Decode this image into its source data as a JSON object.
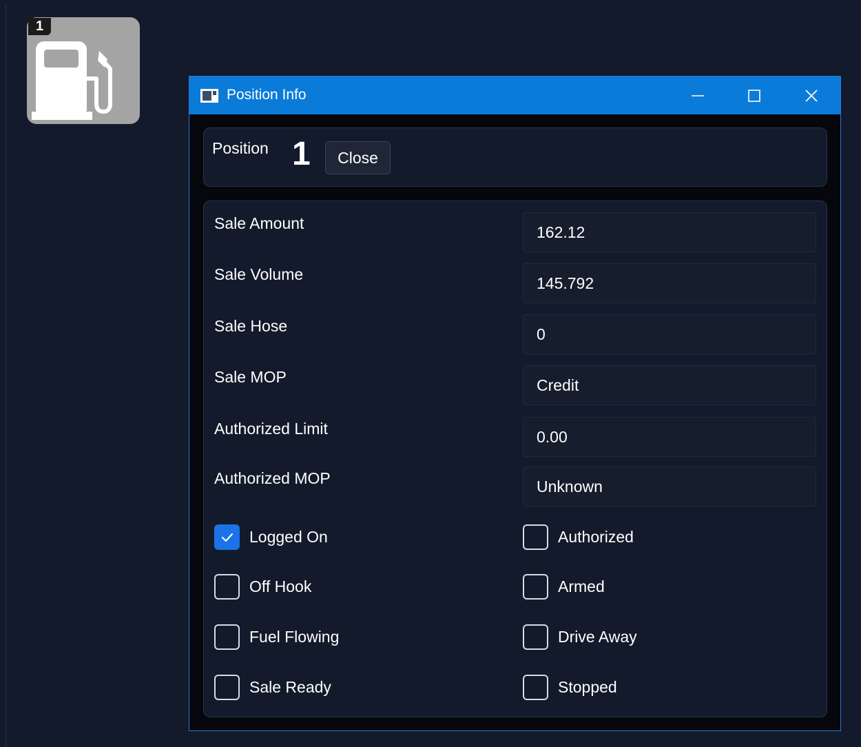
{
  "pump": {
    "badge": "1"
  },
  "window": {
    "title": "Position Info",
    "position_label": "Position",
    "position_number": "1",
    "close_label": "Close"
  },
  "fields": [
    {
      "label": "Sale Amount",
      "value": "162.12"
    },
    {
      "label": "Sale Volume",
      "value": "145.792"
    },
    {
      "label": "Sale Hose",
      "value": "0"
    },
    {
      "label": "Sale MOP",
      "value": "Credit"
    },
    {
      "label": "Authorized Limit",
      "value": "0.00"
    },
    {
      "label": "Authorized MOP",
      "value": "Unknown"
    }
  ],
  "checks": [
    {
      "label": "Logged On",
      "checked": true
    },
    {
      "label": "Authorized",
      "checked": false
    },
    {
      "label": "Off Hook",
      "checked": false
    },
    {
      "label": "Armed",
      "checked": false
    },
    {
      "label": "Fuel Flowing",
      "checked": false
    },
    {
      "label": "Drive Away",
      "checked": false
    },
    {
      "label": "Sale Ready",
      "checked": false
    },
    {
      "label": "Stopped",
      "checked": false
    }
  ],
  "colors": {
    "accent": "#0a7bd8",
    "checkbox_on": "#1a73e8",
    "background": "#131a2b",
    "tile": "#a4a4a4"
  }
}
